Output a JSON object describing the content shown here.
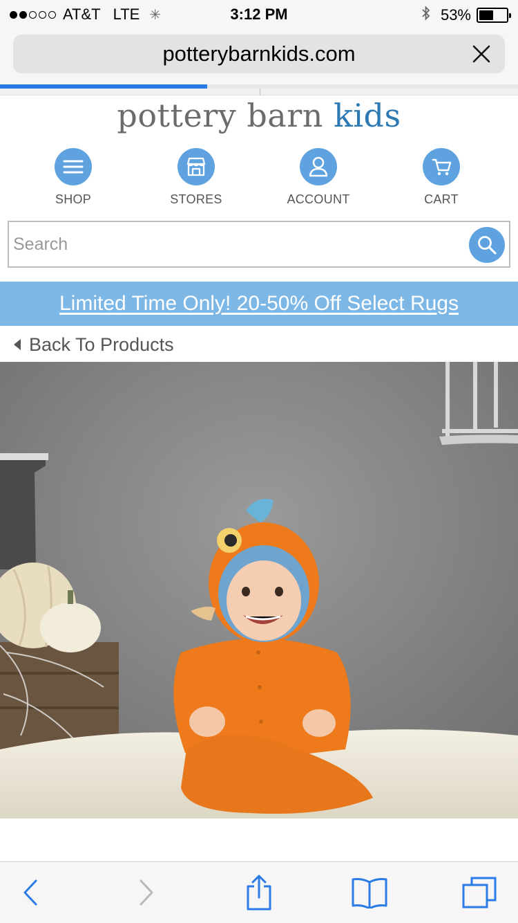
{
  "status_bar": {
    "carrier": "AT&T",
    "network": "LTE",
    "time": "3:12 PM",
    "battery_percent": "53%",
    "battery_level": 0.53,
    "signal_bars": 2
  },
  "browser": {
    "url": "potterybarnkids.com",
    "load_progress": 0.4
  },
  "logo": {
    "part1": "pottery barn ",
    "part2": "kids"
  },
  "nav": {
    "shop": "SHOP",
    "stores": "STORES",
    "account": "ACCOUNT",
    "cart": "CART"
  },
  "search": {
    "placeholder": "Search",
    "value": ""
  },
  "promo": {
    "text": "Limited Time Only! 20-50% Off Select Rugs"
  },
  "back_link": {
    "label": "Back To Products"
  },
  "colors": {
    "accent_blue": "#5ea2e0",
    "promo_blue": "#7cb7e6",
    "logo_gray": "#6b6b6b",
    "logo_blue": "#2d79b3",
    "toolbar_blue": "#2a7be6"
  },
  "icons": {
    "shop": "hamburger-menu-icon",
    "stores": "storefront-icon",
    "account": "user-icon",
    "cart": "shopping-cart-icon",
    "search": "magnifier-icon",
    "toolbar": [
      "back-arrow-icon",
      "forward-arrow-icon",
      "share-icon",
      "bookmarks-icon",
      "tabs-icon"
    ]
  }
}
